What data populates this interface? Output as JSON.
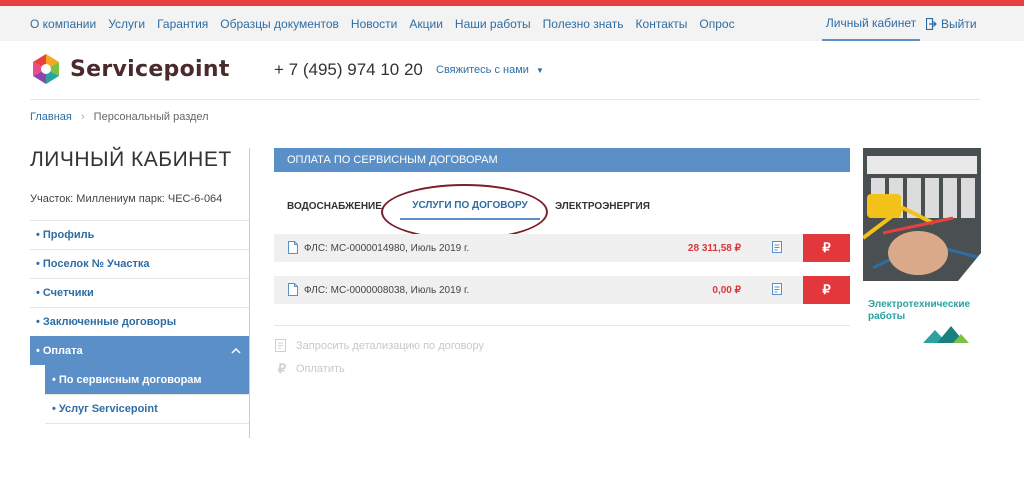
{
  "topnav": {
    "links": [
      "О компании",
      "Услуги",
      "Гарантия",
      "Образцы документов",
      "Новости",
      "Акции",
      "Наши работы",
      "Полезно знать",
      "Контакты",
      "Опрос"
    ],
    "cabinet": "Личный кабинет",
    "logout": "Выйти"
  },
  "header": {
    "brand": "Servicepoint",
    "phone": "+ 7 (495) 974 10 20",
    "contact": "Свяжитесь с нами"
  },
  "breadcrumb": {
    "home": "Главная",
    "current": "Персональный раздел"
  },
  "sidebar": {
    "title": "ЛИЧНЫЙ КАБИНЕТ",
    "site": "Участок: Миллениум парк: ЧЕС-6-064",
    "items": [
      {
        "label": "Профиль"
      },
      {
        "label": "Поселок № Участка"
      },
      {
        "label": "Счетчики"
      },
      {
        "label": "Заключенные договоры"
      },
      {
        "label": "Оплата"
      }
    ],
    "subitems": [
      {
        "label": "По сервисным договорам"
      },
      {
        "label": "Услуг Servicepoint"
      }
    ]
  },
  "main": {
    "panel_title": "ОПЛАТА ПО СЕРВИСНЫМ ДОГОВОРАМ",
    "tabs": [
      {
        "label": "ВОДОСНАБЖЕНИЕ"
      },
      {
        "label": "УСЛУГИ ПО ДОГОВОРУ"
      },
      {
        "label": "ЭЛЕКТРОЭНЕРГИЯ"
      }
    ],
    "rows": [
      {
        "label": "ФЛС: МС-0000014980, Июль 2019 г.",
        "amount": "28 311,58 ₽"
      },
      {
        "label": "ФЛС: МС-0000008038, Июль 2019 г.",
        "amount": "0,00 ₽"
      }
    ],
    "actions": {
      "detail": "Запросить детализацию по договору",
      "pay": "Оплатить"
    },
    "currency_sign": "₽"
  },
  "ad": {
    "line1": "Электротехнические",
    "line2": "работы"
  },
  "colors": {
    "accent": "#5b8fc7",
    "red": "#e2383b",
    "link": "#2e6da4",
    "teal": "#2aa3a0",
    "ellipse": "#7a1f2b"
  }
}
